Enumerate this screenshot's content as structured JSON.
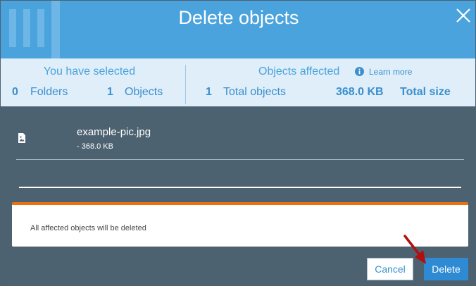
{
  "dialog": {
    "title": "Delete objects",
    "close_icon": "close-icon",
    "accent_color": "#4aa3dd"
  },
  "summary": {
    "selected_heading": "You have selected",
    "folders_count": "0",
    "folders_label": "Folders",
    "objects_count": "1",
    "objects_label": "Objects",
    "affected_heading": "Objects affected",
    "info_icon": "info-icon",
    "learn_more": "Learn more",
    "total_objects_count": "1",
    "total_objects_label": "Total objects",
    "total_size_value": "368.0 KB",
    "total_size_label": "Total size"
  },
  "file": {
    "icon": "image-file-icon",
    "name": "example-pic.jpg",
    "size": "- 368.0 KB"
  },
  "warning": {
    "text": "All affected objects will be deleted",
    "accent_color": "#ec7211"
  },
  "footer": {
    "cancel_label": "Cancel",
    "delete_label": "Delete",
    "annotation_icon": "red-arrow-icon"
  }
}
